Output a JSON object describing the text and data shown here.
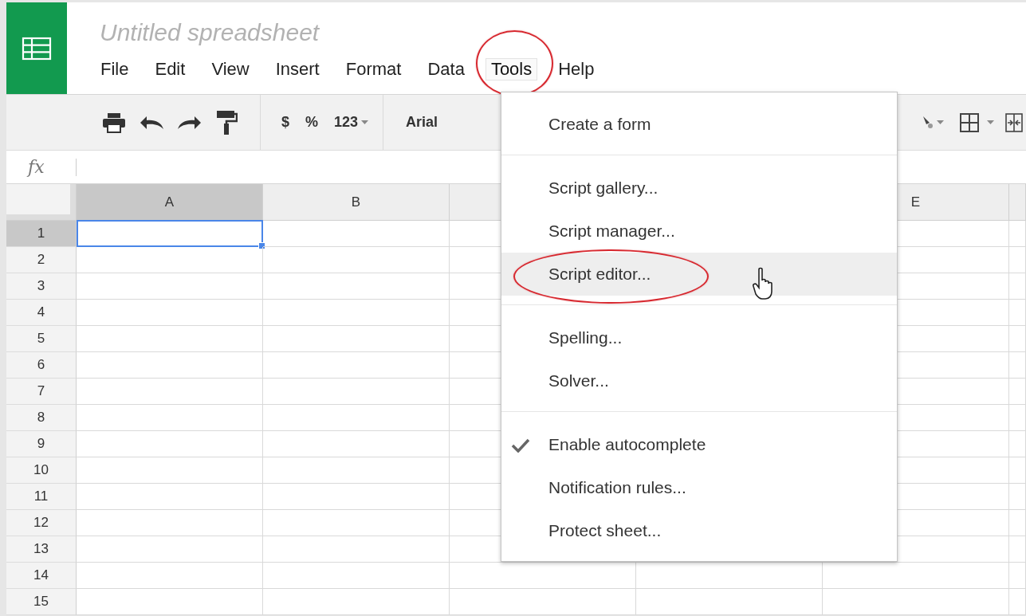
{
  "app": {
    "title": "Untitled spreadsheet"
  },
  "menu_bar": [
    {
      "label": "File",
      "selected": false
    },
    {
      "label": "Edit",
      "selected": false
    },
    {
      "label": "View",
      "selected": false
    },
    {
      "label": "Insert",
      "selected": false
    },
    {
      "label": "Format",
      "selected": false
    },
    {
      "label": "Data",
      "selected": false
    },
    {
      "label": "Tools",
      "selected": true
    },
    {
      "label": "Help",
      "selected": false
    }
  ],
  "toolbar": {
    "currency": "$",
    "percent": "%",
    "number_format": "123",
    "font": "Arial"
  },
  "formula_bar": {
    "label": "fx"
  },
  "grid": {
    "columns": [
      {
        "label": "A",
        "selected": true
      },
      {
        "label": "B",
        "selected": false
      },
      {
        "selected": false
      },
      {},
      {
        "label": "E",
        "selected": false
      },
      {
        "selected": false
      }
    ],
    "rows": [
      {
        "label": "1",
        "selected": true
      },
      {
        "label": "2",
        "selected": false
      },
      {
        "label": "3",
        "selected": false
      },
      {
        "label": "4",
        "selected": false
      },
      {
        "label": "5",
        "selected": false
      },
      {
        "label": "6",
        "selected": false
      },
      {
        "label": "7",
        "selected": false
      },
      {
        "label": "8",
        "selected": false
      },
      {
        "label": "9",
        "selected": false
      },
      {
        "label": "10",
        "selected": false
      },
      {
        "label": "11",
        "selected": false
      },
      {
        "label": "12",
        "selected": false
      },
      {
        "label": "13",
        "selected": false
      },
      {
        "label": "14",
        "selected": false
      },
      {
        "label": "15",
        "selected": false
      }
    ]
  },
  "tools_menu": {
    "sections": [
      {
        "items": [
          {
            "label": "Create a form",
            "highlighted": false,
            "checked": false
          }
        ]
      },
      {
        "items": [
          {
            "label": "Script gallery...",
            "highlighted": false,
            "checked": false
          },
          {
            "label": "Script manager...",
            "highlighted": false,
            "checked": false
          },
          {
            "label": "Script editor...",
            "highlighted": true,
            "checked": false
          }
        ]
      },
      {
        "items": [
          {
            "label": "Spelling...",
            "highlighted": false,
            "checked": false
          },
          {
            "label": "Solver...",
            "highlighted": false,
            "checked": false
          }
        ]
      },
      {
        "items": [
          {
            "label": "Enable autocomplete",
            "highlighted": false,
            "checked": true
          },
          {
            "label": "Notification rules...",
            "highlighted": false,
            "checked": false
          },
          {
            "label": "Protect sheet...",
            "highlighted": false,
            "checked": false
          }
        ]
      }
    ]
  }
}
